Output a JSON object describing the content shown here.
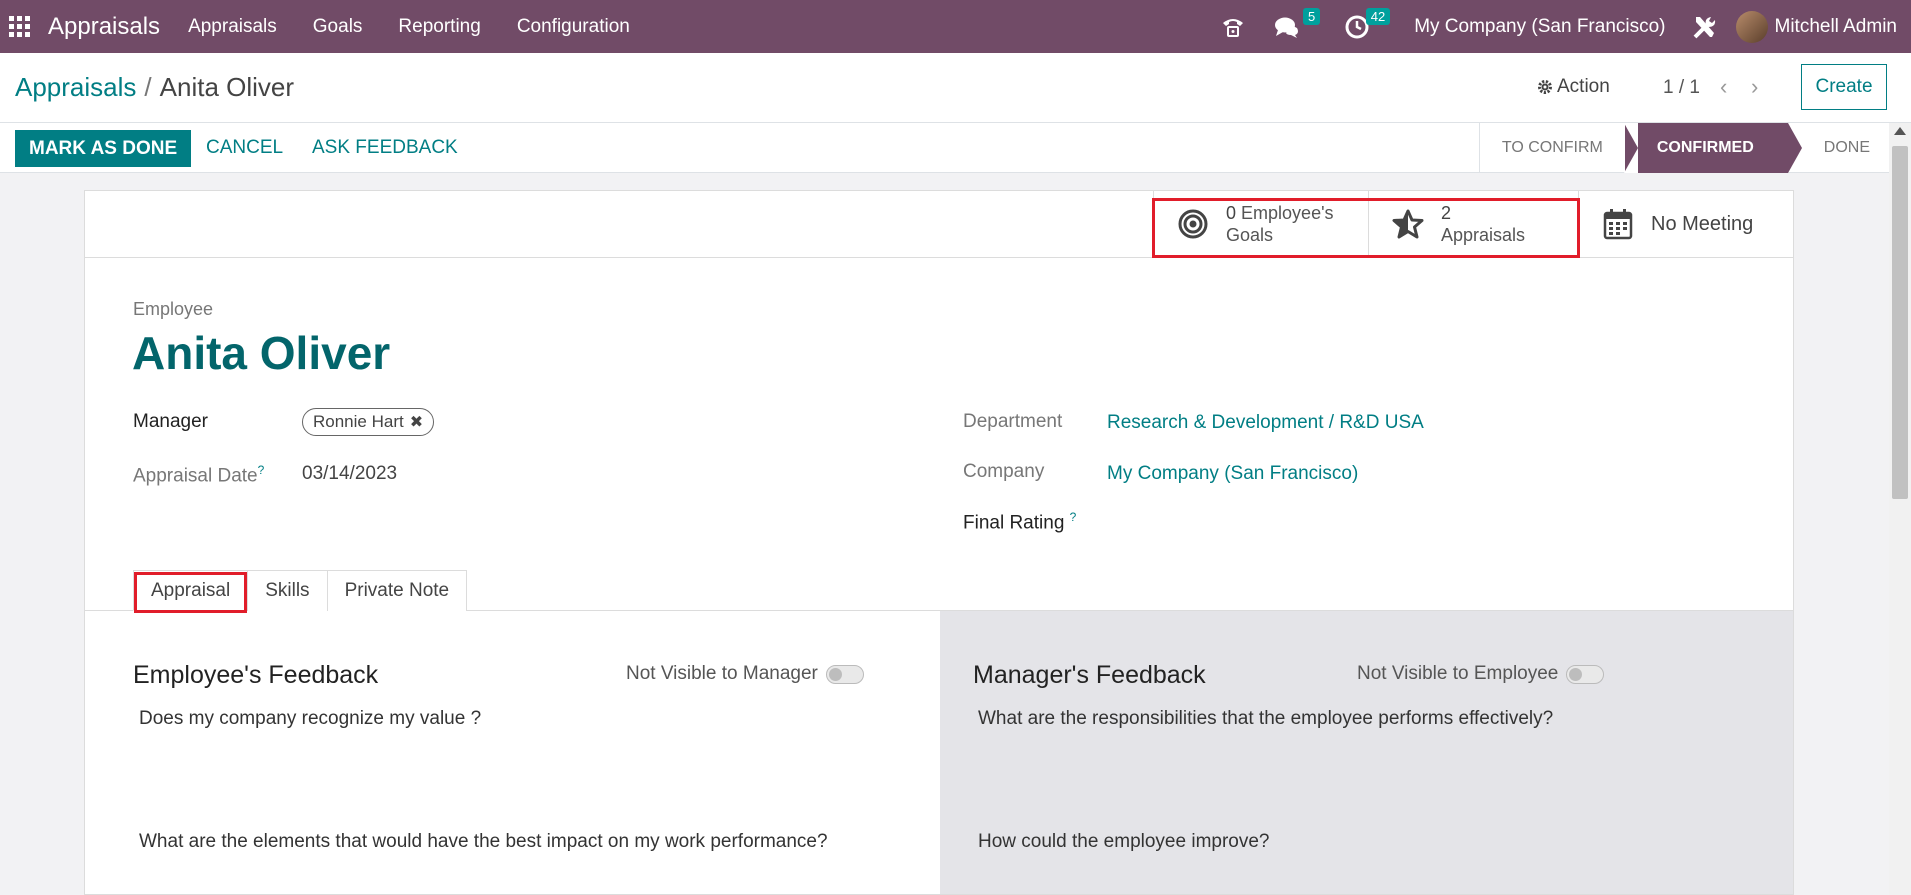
{
  "navbar": {
    "brand": "Appraisals",
    "menu": [
      "Appraisals",
      "Goals",
      "Reporting",
      "Configuration"
    ],
    "messages_count": "5",
    "activities_count": "42",
    "company": "My Company (San Francisco)",
    "user": "Mitchell Admin"
  },
  "control_panel": {
    "breadcrumb_parent": "Appraisals",
    "breadcrumb_separator": "/",
    "breadcrumb_current": "Anita Oliver",
    "action_label": "Action",
    "pager": "1 / 1",
    "create_label": "Create"
  },
  "statusbar": {
    "mark_done_label": "MARK AS DONE",
    "cancel_label": "CANCEL",
    "ask_feedback_label": "ASK FEEDBACK",
    "stages": [
      "TO CONFIRM",
      "CONFIRMED",
      "DONE"
    ],
    "active_stage": "CONFIRMED"
  },
  "smart_buttons": {
    "goals_value": "0",
    "goals_label_1": "Employee's",
    "goals_label_2": "Goals",
    "appraisals_value": "2",
    "appraisals_label": "Appraisals",
    "meeting_label": "No Meeting"
  },
  "employee": {
    "label": "Employee",
    "name": "Anita Oliver"
  },
  "fields": {
    "manager_label": "Manager",
    "manager_value": "Ronnie Hart",
    "appraisal_date_label": "Appraisal Date",
    "appraisal_date_value": "03/14/2023",
    "department_label": "Department",
    "department_value": "Research & Development / R&D USA",
    "company_label": "Company",
    "company_value": "My Company (San Francisco)",
    "final_rating_label": "Final Rating",
    "help_mark": "?"
  },
  "tabs": [
    "Appraisal",
    "Skills",
    "Private Note"
  ],
  "employee_feedback": {
    "title": "Employee's Feedback",
    "visibility_label": "Not Visible to Manager",
    "questions": [
      "Does my company recognize my value ?",
      "What are the elements that would have the best impact on my work performance?"
    ]
  },
  "manager_feedback": {
    "title": "Manager's Feedback",
    "visibility_label": "Not Visible to Employee",
    "questions": [
      "What are the responsibilities that the employee performs effectively?",
      "How could the employee improve?"
    ]
  },
  "colors": {
    "brand": "#714b67",
    "accent": "#017e84",
    "highlight": "#e11d2a"
  },
  "icons": [
    "apps-grid-icon",
    "phone-icon",
    "chat-icon",
    "clock-icon",
    "tools-icon",
    "gear-icon",
    "chevron-left-icon",
    "chevron-right-icon",
    "target-icon",
    "star-icon",
    "calendar-icon",
    "close-icon",
    "help-icon"
  ]
}
